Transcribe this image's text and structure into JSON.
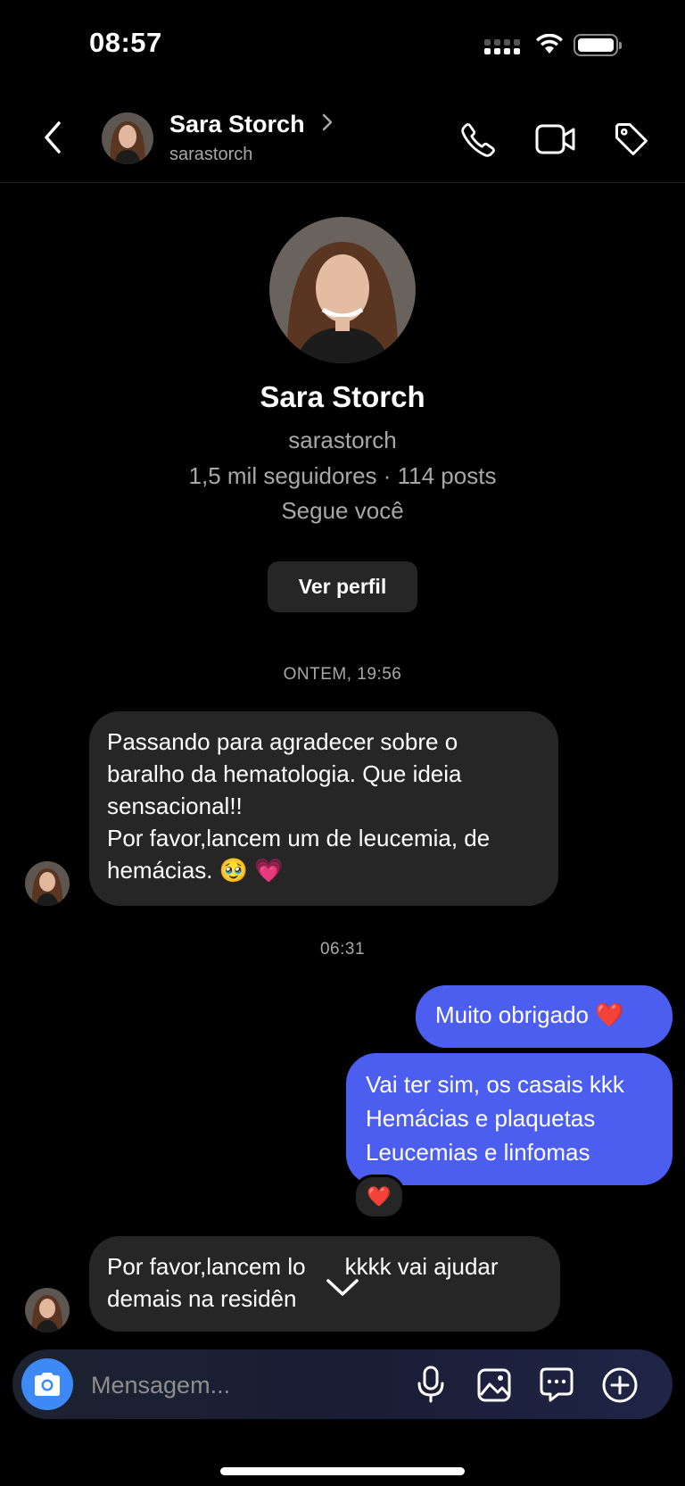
{
  "status_bar": {
    "time": "08:57"
  },
  "header": {
    "name": "Sara Storch",
    "username": "sarastorch",
    "icons": [
      "back-icon",
      "phone-icon",
      "video-icon",
      "tag-icon"
    ]
  },
  "profile": {
    "name": "Sara Storch",
    "username": "sarastorch",
    "stats": "1,5 mil seguidores · 114 posts",
    "follows": "Segue você",
    "view_button": "Ver perfil"
  },
  "timestamps": [
    "ONTEM, 19:56",
    "06:31"
  ],
  "messages": [
    {
      "from": "them",
      "lines": [
        "Passando para agradecer sobre o",
        "baralho da hematologia. Que ideia",
        "sensacional!!",
        "Por favor,lancem um de leucemia, de",
        "hemácias. 🥹 💗"
      ]
    },
    {
      "from": "me",
      "lines": [
        "Muito obrigado ❤️"
      ]
    },
    {
      "from": "me",
      "lines": [
        "Vai ter sim, os casais kkk",
        "Hemácias e plaquetas",
        "Leucemias e linfomas"
      ],
      "reaction": "❤️"
    },
    {
      "from": "them",
      "lines": [
        "Por favor,lancem lo",
        "kkkk vai ajudar",
        "demais na residên"
      ]
    }
  ],
  "composer": {
    "placeholder": "Mensagem..."
  },
  "colors": {
    "outgoing_bubble": "#4c5ef0",
    "incoming_bubble": "#262626",
    "camera_button": "#3d8af7"
  }
}
